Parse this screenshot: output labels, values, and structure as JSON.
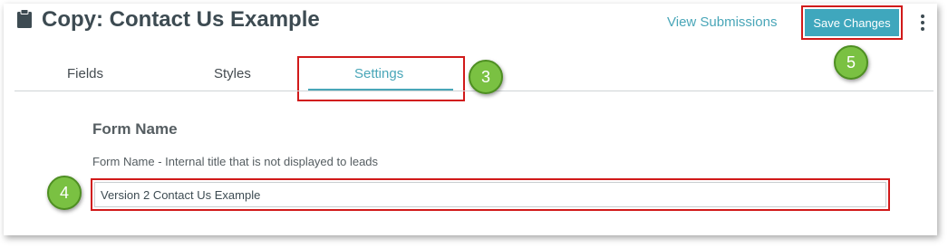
{
  "header": {
    "title": "Copy: Contact Us Example",
    "title_icon": "clipboard-icon",
    "view_submissions_label": "View Submissions",
    "save_label": "Save Changes",
    "more_icon": "more-vertical-icon"
  },
  "tabs": [
    {
      "label": "Fields",
      "active": false
    },
    {
      "label": "Styles",
      "active": false
    },
    {
      "label": "Settings",
      "active": true
    }
  ],
  "settings": {
    "section_title": "Form Name",
    "field_label": "Form Name - Internal title that is not displayed to leads",
    "field_value": "Version 2 Contact Us Example"
  },
  "callouts": [
    "3",
    "4",
    "5"
  ],
  "colors": {
    "accent": "#49a6b8",
    "button_bg": "#3fa7bd",
    "highlight_red": "#d11a1a",
    "callout_green": "#7ac142",
    "text_dark": "#3d4b52"
  }
}
